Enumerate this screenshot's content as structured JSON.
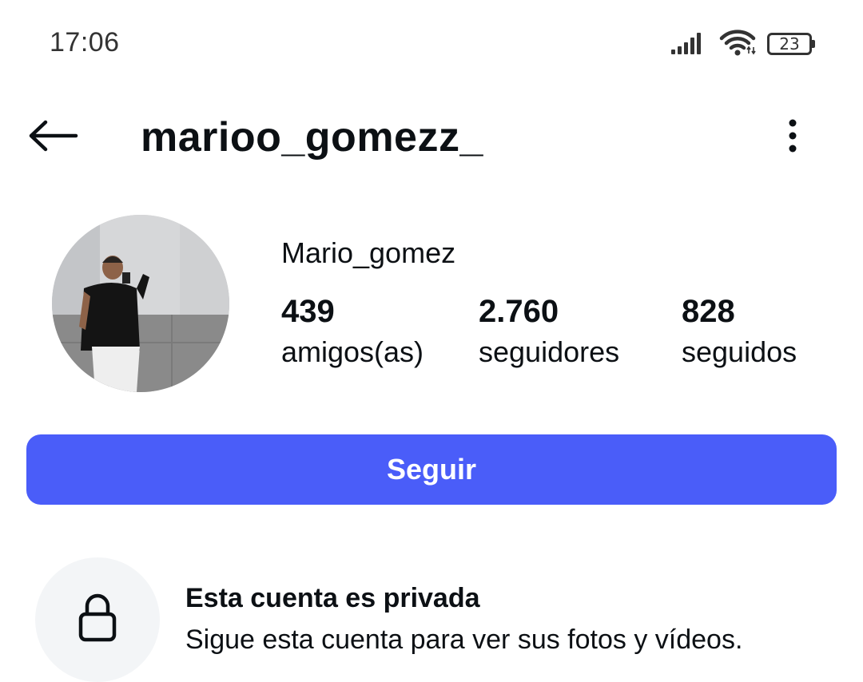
{
  "status_bar": {
    "time": "17:06",
    "battery": "23",
    "icons": [
      "signal-icon",
      "wifi-icon",
      "battery-icon"
    ]
  },
  "header": {
    "username": "marioo_gomezz_",
    "back_icon": "arrow-left-icon",
    "more_icon": "more-vertical-icon"
  },
  "profile": {
    "display_name": "Mario_gomez",
    "stats": [
      {
        "value": "439",
        "label": "amigos(as)"
      },
      {
        "value": "2.760",
        "label": "seguidores"
      },
      {
        "value": "828",
        "label": "seguidos"
      }
    ]
  },
  "actions": {
    "follow_label": "Seguir"
  },
  "private_notice": {
    "title": "Esta cuenta es privada",
    "subtitle": "Sigue esta cuenta para ver sus fotos y vídeos.",
    "icon": "lock-icon"
  },
  "colors": {
    "accent": "#4a5df9",
    "text": "#0c1014",
    "lock_bg": "#f3f5f7"
  }
}
